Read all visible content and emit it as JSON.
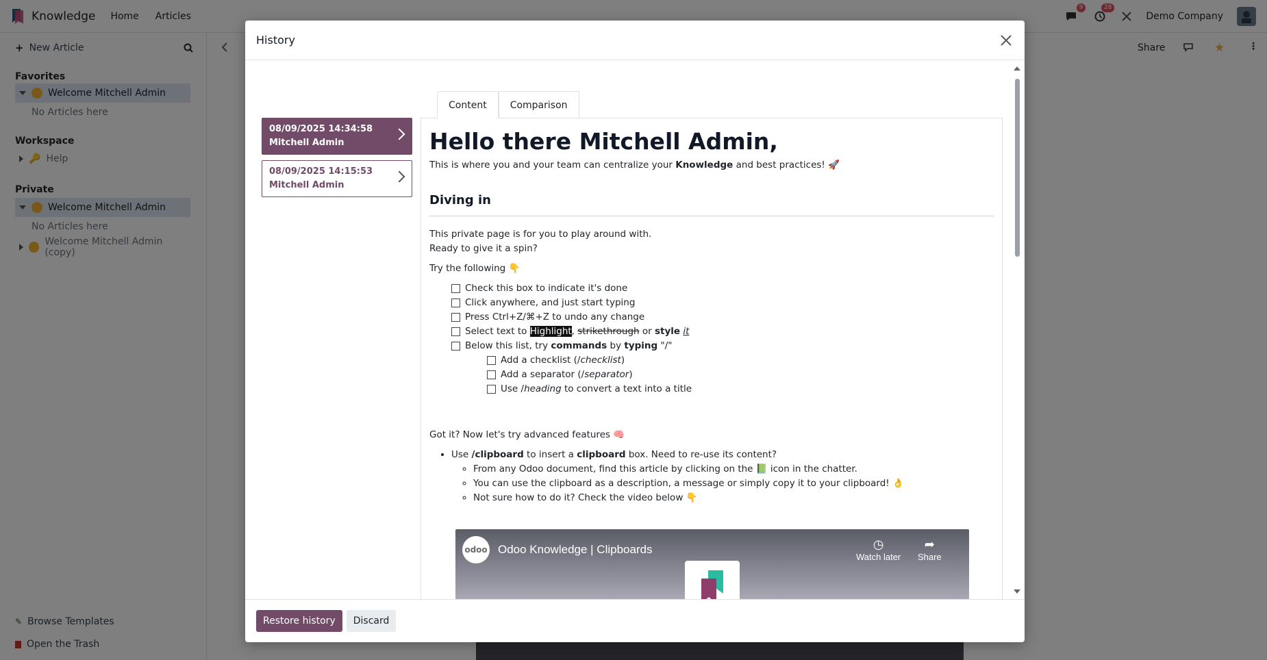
{
  "app": {
    "name": "Knowledge",
    "nav": [
      "Home",
      "Articles"
    ],
    "company": "Demo Company",
    "messages_count": "9",
    "activities_count": "28"
  },
  "sidebar": {
    "new_article": "New Article",
    "favorites_heading": "Favorites",
    "favorites_item": "Welcome Mitchell Admin",
    "favorites_empty": "No Articles here",
    "workspace_heading": "Workspace",
    "workspace_item": "Help",
    "private_heading": "Private",
    "private_item": "Welcome Mitchell Admin",
    "private_empty": "No Articles here",
    "private_copy": "Welcome Mitchell Admin (copy)",
    "browse_templates": "Browse Templates",
    "open_trash": "Open the Trash"
  },
  "header_actions": {
    "share": "Share"
  },
  "modal": {
    "title": "History",
    "tabs": [
      "Content",
      "Comparison"
    ],
    "versions": [
      {
        "date": "08/09/2025 14:34:58",
        "author": "Mitchell Admin"
      },
      {
        "date": "08/09/2025 14:15:53",
        "author": "Mitchell Admin"
      }
    ],
    "restore_label": "Restore history",
    "discard_label": "Discard"
  },
  "doc": {
    "title": "Hello there Mitchell Admin,",
    "intro_before": "This is where you and your team can centralize your ",
    "intro_bold": "Knowledge",
    "intro_after": " and best practices! 🚀",
    "section": "Diving in",
    "para1": "This private page is for you to play around with.",
    "para2": "Ready to give it a spin?",
    "try": "Try the following 👇",
    "check1": "Check this box to indicate it's done",
    "check2": "Click anywhere, and just start typing",
    "check3": "Press Ctrl+Z/⌘+Z to undo any change",
    "check4_pre": "Select text to ",
    "check4_highlight": "Highlight",
    "check4_comma": ", ",
    "check4_strike": "strikethrough",
    "check4_or": " or ",
    "check4_bold": "style",
    "check4_italic": "it",
    "check5_pre": "Below this list, try ",
    "check5_bold1": "commands",
    "check5_mid": " by ",
    "check5_bold2": "typing",
    "check5_quote": " \"/\"",
    "sub1_pre": "Add a checklist (/",
    "sub1_it": "checklist",
    "sub1_post": ")",
    "sub2_pre": "Add a separator (/",
    "sub2_it": "separator",
    "sub2_post": ")",
    "sub3_pre": "Use /",
    "sub3_it": "heading",
    "sub3_post": " to convert a text into a title",
    "advanced": "Got it? Now let's try advanced features 🧠",
    "bullet_pre": "Use ",
    "bullet_b1": "/clipboard",
    "bullet_mid": " to insert a ",
    "bullet_b2": "clipboard",
    "bullet_post": " box. Need to re-use its content?",
    "sub_b1": "From any Odoo document, find this article by clicking on the 📗 icon in the chatter.",
    "sub_b2": "You can use the clipboard as a description, a message or simply copy it to your clipboard! 👌",
    "sub_b3": "Not sure how to do it? Check the video below 👇"
  },
  "video": {
    "logo": "odoo",
    "title": "Odoo Knowledge | Clipboards",
    "watch_later": "Watch later",
    "share": "Share"
  }
}
